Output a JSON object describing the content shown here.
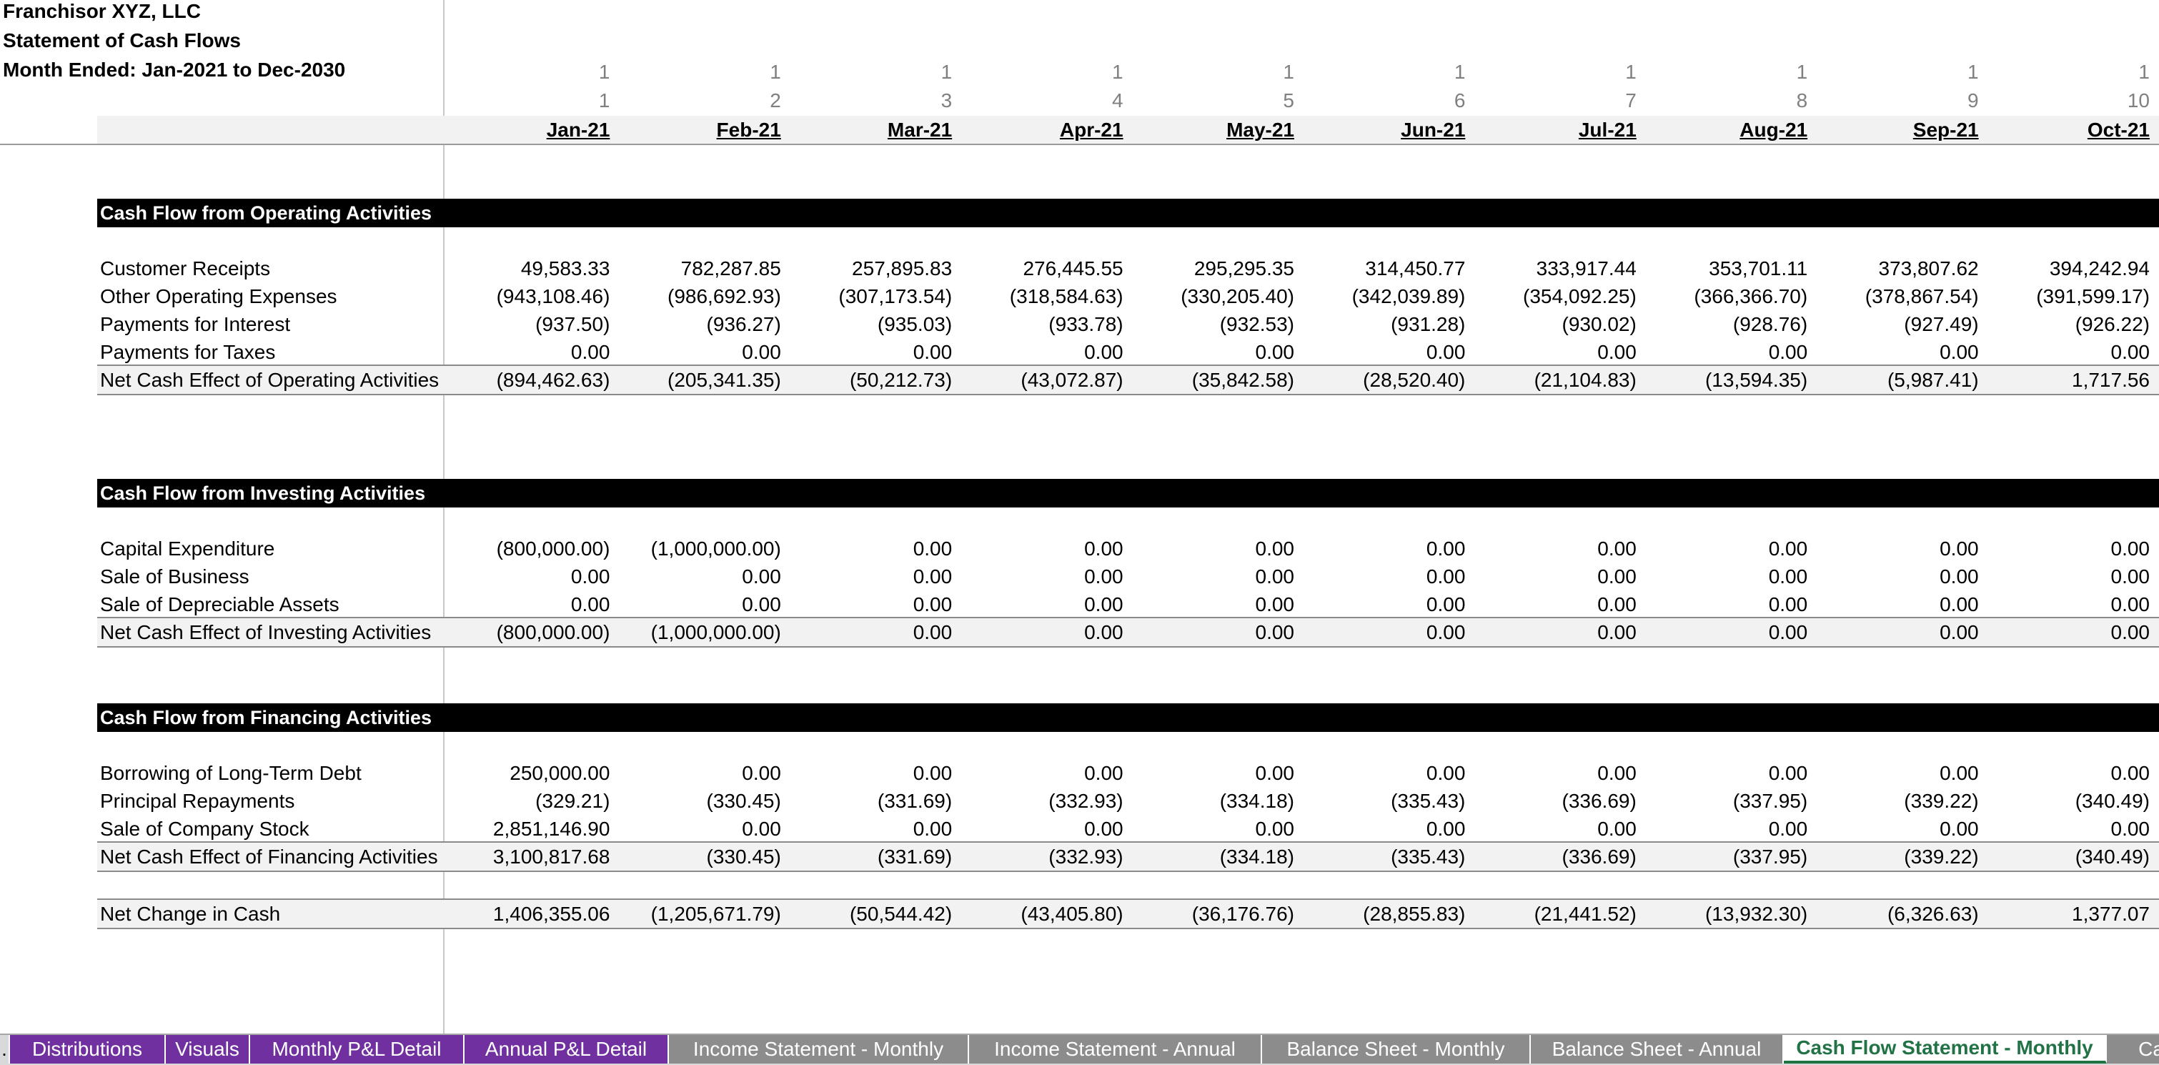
{
  "header": {
    "company": "Franchisor XYZ, LLC",
    "statement": "Statement of Cash Flows",
    "period": "Month Ended: Jan-2021 to Dec-2030"
  },
  "counter_row_1": [
    "1",
    "1",
    "1",
    "1",
    "1",
    "1",
    "1",
    "1",
    "1",
    "1"
  ],
  "counter_row_2": [
    "1",
    "2",
    "3",
    "4",
    "5",
    "6",
    "7",
    "8",
    "9",
    "10"
  ],
  "months": [
    "Jan-21",
    "Feb-21",
    "Mar-21",
    "Apr-21",
    "May-21",
    "Jun-21",
    "Jul-21",
    "Aug-21",
    "Sep-21",
    "Oct-21"
  ],
  "sections": {
    "operating": {
      "title": "Cash Flow from Operating Activities",
      "rows": [
        {
          "label": "Customer Receipts",
          "values": [
            "49,583.33",
            "782,287.85",
            "257,895.83",
            "276,445.55",
            "295,295.35",
            "314,450.77",
            "333,917.44",
            "353,701.11",
            "373,807.62",
            "394,242.94"
          ]
        },
        {
          "label": "Other Operating Expenses",
          "values": [
            "(943,108.46)",
            "(986,692.93)",
            "(307,173.54)",
            "(318,584.63)",
            "(330,205.40)",
            "(342,039.89)",
            "(354,092.25)",
            "(366,366.70)",
            "(378,867.54)",
            "(391,599.17)"
          ]
        },
        {
          "label": "Payments for Interest",
          "values": [
            "(937.50)",
            "(936.27)",
            "(935.03)",
            "(933.78)",
            "(932.53)",
            "(931.28)",
            "(930.02)",
            "(928.76)",
            "(927.49)",
            "(926.22)"
          ]
        },
        {
          "label": "Payments for Taxes",
          "values": [
            "0.00",
            "0.00",
            "0.00",
            "0.00",
            "0.00",
            "0.00",
            "0.00",
            "0.00",
            "0.00",
            "0.00"
          ]
        }
      ],
      "total": {
        "label": "Net Cash Effect of Operating Activities",
        "values": [
          "(894,462.63)",
          "(205,341.35)",
          "(50,212.73)",
          "(43,072.87)",
          "(35,842.58)",
          "(28,520.40)",
          "(21,104.83)",
          "(13,594.35)",
          "(5,987.41)",
          "1,717.56"
        ]
      }
    },
    "investing": {
      "title": "Cash Flow from Investing Activities",
      "rows": [
        {
          "label": "Capital Expenditure",
          "values": [
            "(800,000.00)",
            "(1,000,000.00)",
            "0.00",
            "0.00",
            "0.00",
            "0.00",
            "0.00",
            "0.00",
            "0.00",
            "0.00"
          ]
        },
        {
          "label": "Sale of Business",
          "values": [
            "0.00",
            "0.00",
            "0.00",
            "0.00",
            "0.00",
            "0.00",
            "0.00",
            "0.00",
            "0.00",
            "0.00"
          ]
        },
        {
          "label": "Sale of Depreciable Assets",
          "values": [
            "0.00",
            "0.00",
            "0.00",
            "0.00",
            "0.00",
            "0.00",
            "0.00",
            "0.00",
            "0.00",
            "0.00"
          ]
        }
      ],
      "total": {
        "label": "Net Cash Effect of Investing Activities",
        "values": [
          "(800,000.00)",
          "(1,000,000.00)",
          "0.00",
          "0.00",
          "0.00",
          "0.00",
          "0.00",
          "0.00",
          "0.00",
          "0.00"
        ]
      }
    },
    "financing": {
      "title": "Cash Flow from Financing Activities",
      "rows": [
        {
          "label": "Borrowing of Long-Term Debt",
          "values": [
            "250,000.00",
            "0.00",
            "0.00",
            "0.00",
            "0.00",
            "0.00",
            "0.00",
            "0.00",
            "0.00",
            "0.00"
          ]
        },
        {
          "label": "Principal Repayments",
          "values": [
            "(329.21)",
            "(330.45)",
            "(331.69)",
            "(332.93)",
            "(334.18)",
            "(335.43)",
            "(336.69)",
            "(337.95)",
            "(339.22)",
            "(340.49)"
          ]
        },
        {
          "label": "Sale of Company Stock",
          "values": [
            "2,851,146.90",
            "0.00",
            "0.00",
            "0.00",
            "0.00",
            "0.00",
            "0.00",
            "0.00",
            "0.00",
            "0.00"
          ]
        }
      ],
      "total": {
        "label": "Net Cash Effect of Financing Activities",
        "values": [
          "3,100,817.68",
          "(330.45)",
          "(331.69)",
          "(332.93)",
          "(334.18)",
          "(335.43)",
          "(336.69)",
          "(337.95)",
          "(339.22)",
          "(340.49)"
        ]
      }
    }
  },
  "net_change": {
    "label": "Net Change in Cash",
    "values": [
      "1,406,355.06",
      "(1,205,671.79)",
      "(50,544.42)",
      "(43,405.80)",
      "(36,176.76)",
      "(28,855.83)",
      "(21,441.52)",
      "(13,932.30)",
      "(6,326.63)",
      "1,377.07"
    ]
  },
  "tabs": [
    {
      "label": ".",
      "style": "dot"
    },
    {
      "label": "Distributions",
      "style": "purple"
    },
    {
      "label": "Visuals",
      "style": "purple"
    },
    {
      "label": "Monthly P&L Detail",
      "style": "purple"
    },
    {
      "label": "Annual P&L Detail",
      "style": "purple"
    },
    {
      "label": "Income Statement - Monthly",
      "style": "gray"
    },
    {
      "label": "Income Statement - Annual",
      "style": "gray"
    },
    {
      "label": "Balance Sheet - Monthly",
      "style": "gray"
    },
    {
      "label": "Balance Sheet - Annual",
      "style": "gray"
    },
    {
      "label": "Cash Flow Statement - Monthly",
      "style": "active"
    },
    {
      "label": "Cas",
      "style": "gray"
    }
  ]
}
